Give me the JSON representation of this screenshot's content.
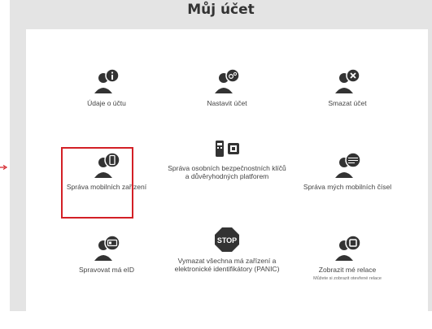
{
  "page": {
    "title": "Můj účet"
  },
  "tiles": [
    {
      "label": "Údaje o účtu",
      "icon": "user-info-icon"
    },
    {
      "label": "Nastavit účet",
      "icon": "user-gear-icon"
    },
    {
      "label": "Smazat účet",
      "icon": "user-delete-icon"
    },
    {
      "label": "Správa mobilních zařízení",
      "icon": "user-mobile-icon"
    },
    {
      "label": "Správa osobních bezpečnostních klíčů a důvěryhodných platforem",
      "icon": "security-key-icon"
    },
    {
      "label": "Správa mých mobilních čísel",
      "icon": "user-phone-number-icon"
    },
    {
      "label": "Spravovat má eID",
      "icon": "user-eid-icon"
    },
    {
      "label": "Vymazat všechna má zařízení a elektronické identifikátory (PANIC)",
      "icon": "stop-sign-icon"
    },
    {
      "label": "Zobrazit mé relace",
      "sub": "Můžete si zobrazit otevřené relace",
      "icon": "user-session-icon"
    }
  ],
  "colors": {
    "icon": "#333333",
    "highlight": "#d32026",
    "arrow": "#d32026"
  }
}
